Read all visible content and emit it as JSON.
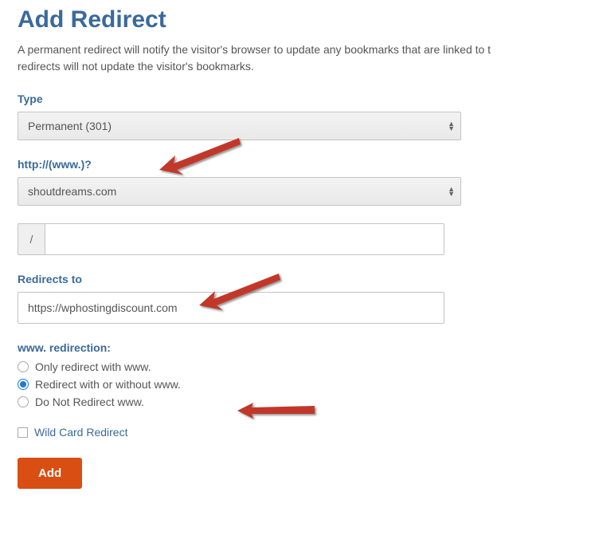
{
  "title": "Add Redirect",
  "description_line1": "A permanent redirect will notify the visitor's browser to update any bookmarks that are linked to t",
  "description_line2": "redirects will not update the visitor's bookmarks.",
  "type_label": "Type",
  "type_value": "Permanent (301)",
  "domain_label": "http://(www.)?",
  "domain_value": "shoutdreams.com",
  "path_prefix": "/",
  "path_value": "",
  "redirects_to_label": "Redirects to",
  "redirects_to_value": "https://wphostingdiscount.com",
  "www_redirection_label": "www. redirection:",
  "radio_options": [
    {
      "label": "Only redirect with www.",
      "checked": false
    },
    {
      "label": "Redirect with or without www.",
      "checked": true
    },
    {
      "label": "Do Not Redirect www.",
      "checked": false
    }
  ],
  "wildcard_label": "Wild Card Redirect",
  "wildcard_checked": false,
  "add_button": "Add"
}
